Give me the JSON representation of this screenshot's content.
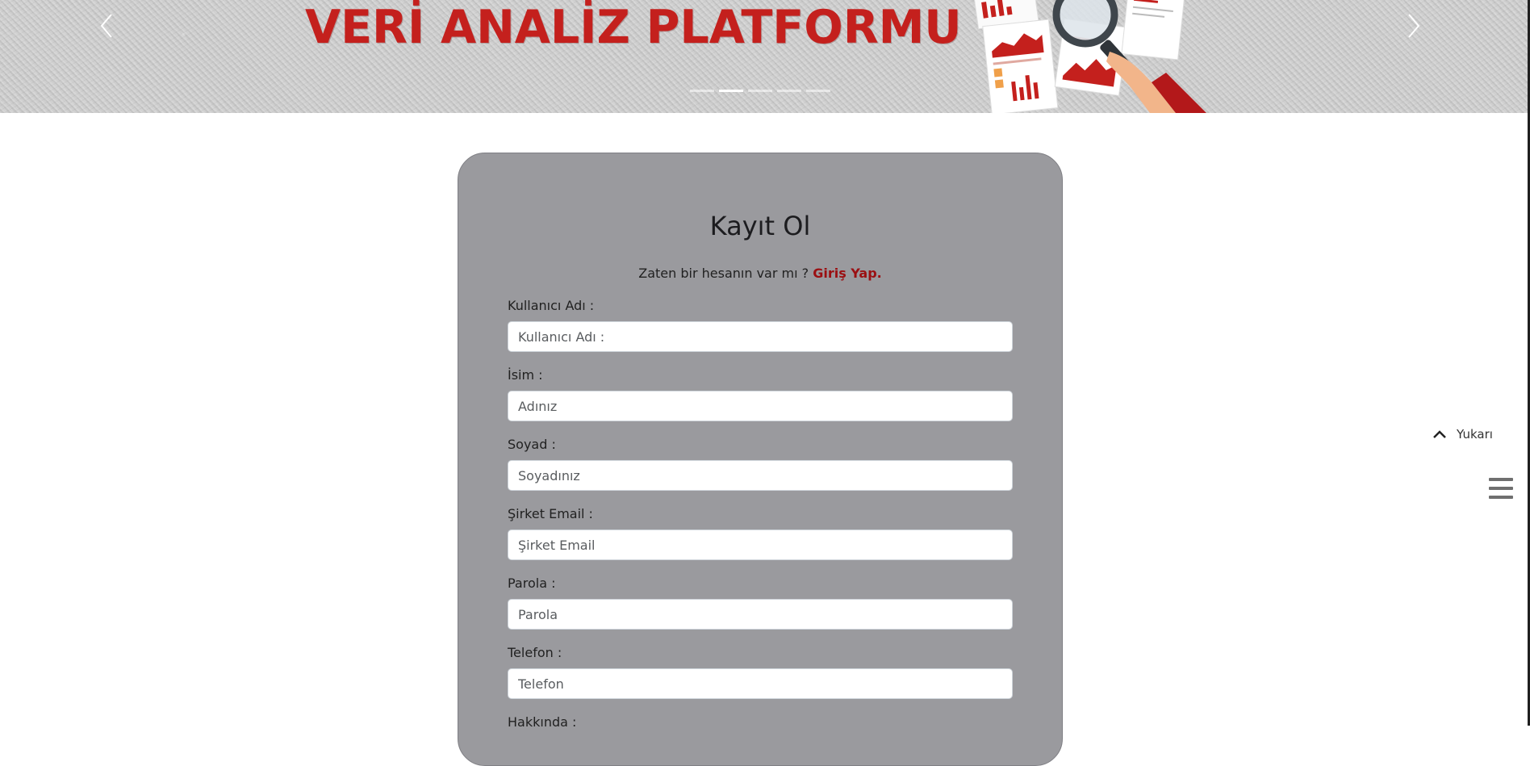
{
  "hero": {
    "title": "VERİ ANALİZ PLATFORMU",
    "indicator_count": 5,
    "active_indicator": 1
  },
  "register": {
    "title": "Kayıt Ol",
    "login_prompt": "Zaten bir hesanın var mı ?",
    "login_link": "Giriş Yap.",
    "fields": [
      {
        "label": "Kullanıcı Adı :",
        "placeholder": "Kullanıcı Adı :"
      },
      {
        "label": "İsim :",
        "placeholder": "Adınız"
      },
      {
        "label": "Soyad :",
        "placeholder": "Soyadınız"
      },
      {
        "label": "Şirket Email :",
        "placeholder": "Şirket Email"
      },
      {
        "label": "Parola :",
        "placeholder": "Parola"
      },
      {
        "label": "Telefon :",
        "placeholder": "Telefon"
      },
      {
        "label": "Hakkında :"
      }
    ]
  },
  "widgets": {
    "back_to_top": "Yukarı"
  },
  "colors": {
    "brand_red": "#c4201d",
    "link_red": "#9b0f12",
    "card_bg": "#9a9a9e"
  },
  "icons": {
    "prev": "chevron-left-icon",
    "next": "chevron-right-icon",
    "top": "chevron-up-icon",
    "menu": "hamburger-menu-icon"
  }
}
